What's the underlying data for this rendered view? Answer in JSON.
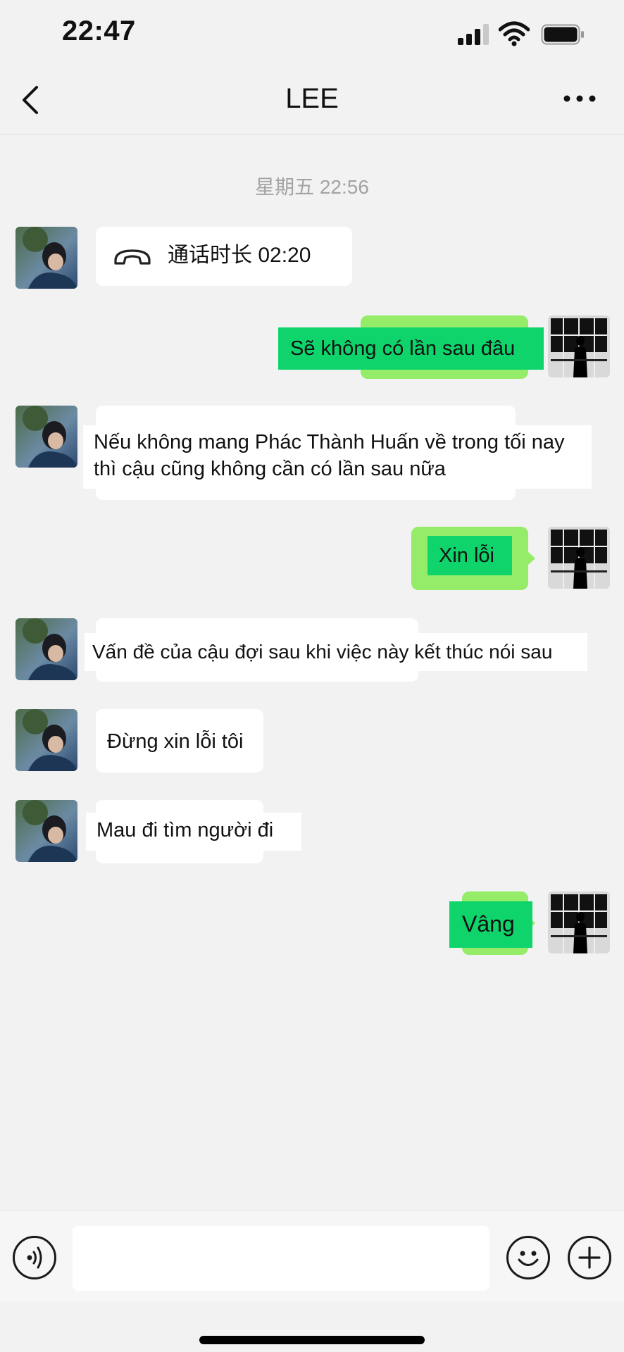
{
  "status_bar": {
    "time": "22:47"
  },
  "nav": {
    "title": "LEE"
  },
  "chat": {
    "timestamp": "星期五 22:56",
    "call_record": "通话时长 02:20",
    "messages": [
      {
        "from": "me",
        "text": "Sẽ không có lần sau đâu"
      },
      {
        "from": "lee",
        "line1": "Nếu không mang Phác Thành Huấn về trong tối nay",
        "line2": "thì cậu cũng không cần có lần sau nữa"
      },
      {
        "from": "me",
        "text": "Xin lỗi"
      },
      {
        "from": "lee",
        "text": "Vấn đề của cậu đợi sau khi việc này kết thúc nói sau"
      },
      {
        "from": "lee",
        "text": "Đừng xin lỗi tôi"
      },
      {
        "from": "lee",
        "text": "Mau đi tìm người đi"
      },
      {
        "from": "me",
        "text": "Vâng"
      }
    ]
  },
  "input": {
    "value": ""
  },
  "icons": [
    "back-icon",
    "more-icon",
    "phone-hangup-icon",
    "voice-icon",
    "emoji-icon",
    "plus-icon"
  ],
  "colors": {
    "background": "#f2f2f2",
    "outgoing_bubble": "#95ec69",
    "incoming_bubble": "#ffffff",
    "highlight_green": "#0ed46b"
  }
}
